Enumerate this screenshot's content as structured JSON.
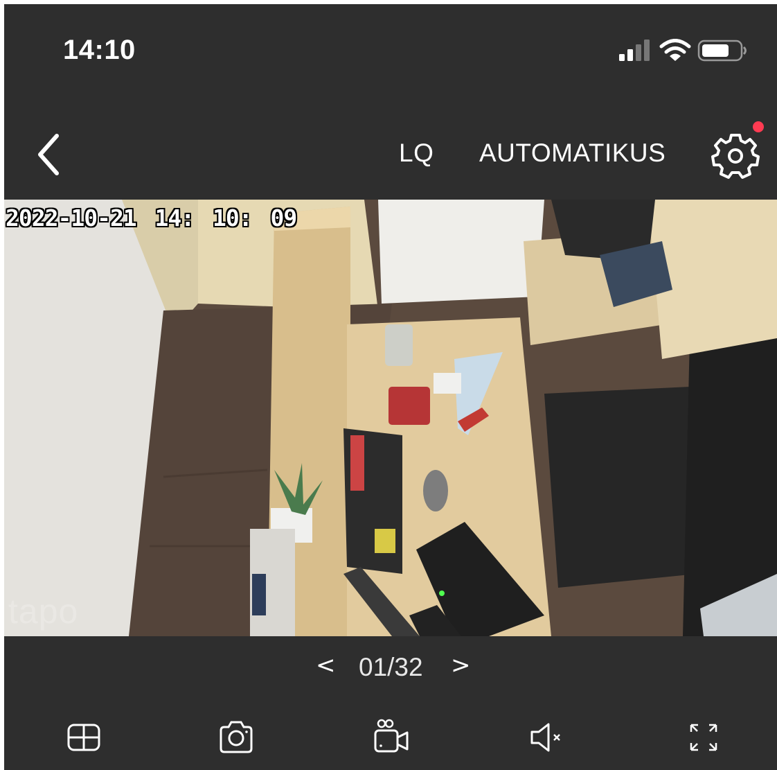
{
  "status_bar": {
    "time": "14:10",
    "icons": [
      "cellular-signal-icon",
      "wifi-icon",
      "battery-icon"
    ]
  },
  "nav": {
    "back_icon": "chevron-left-icon",
    "quality_label": "LQ",
    "mode_label": "AUTOMATIKUS",
    "settings_icon": "gear-icon",
    "notification_color": "#ff3b52"
  },
  "feed": {
    "timestamp": "2022-10-21  14: 10: 09",
    "watermark": "tapo"
  },
  "pager": {
    "prev": "<",
    "current": "01/32",
    "next": ">"
  },
  "toolbar": {
    "items": [
      "grid-view-icon",
      "camera-snapshot-icon",
      "video-record-icon",
      "speaker-muted-icon",
      "fullscreen-icon"
    ]
  },
  "colors": {
    "background": "#2e2e2e",
    "text": "#ffffff"
  }
}
